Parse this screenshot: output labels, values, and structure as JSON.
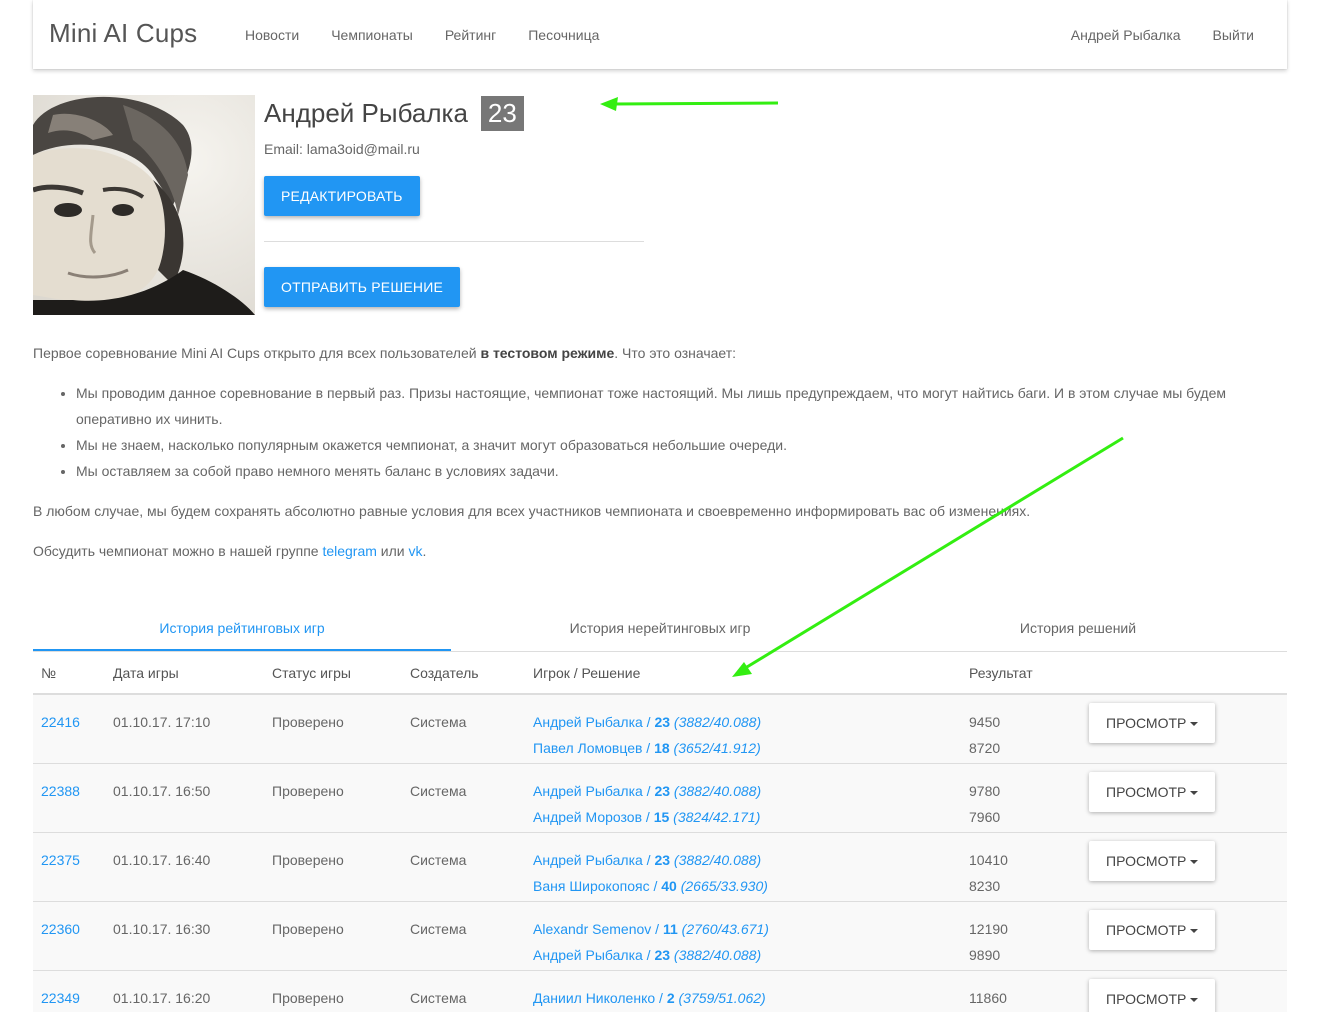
{
  "navbar": {
    "brand": "Mini AI Cups",
    "links": [
      "Новости",
      "Чемпионаты",
      "Рейтинг",
      "Песочница"
    ],
    "user": "Андрей Рыбалка",
    "logout": "Выйти"
  },
  "profile": {
    "name": "Андрей Рыбалка",
    "rating": "23",
    "email": "Email: lama3oid@mail.ru",
    "edit_button": "Редактировать",
    "submit_button": "Отправить решение"
  },
  "content": {
    "intro_pre": "Первое соревнование Mini AI Cups открыто для всех пользователей ",
    "intro_bold": "в тестовом режиме",
    "intro_post": ". Что это означает:",
    "bullets": [
      "Мы проводим данное соревнование в первый раз. Призы настоящие, чемпионат тоже настоящий. Мы лишь предупреждаем, что могут найтись баги. И в этом случае мы будем оперативно их чинить.",
      "Мы не знаем, насколько популярным окажется чемпионат, а значит могут образоваться небольшие очереди.",
      "Мы оставляем за собой право немного менять баланс в условиях задачи."
    ],
    "paragraph2": "В любом случае, мы будем сохранять абсолютно равные условия для всех участников чемпионата и своевременно информировать вас об изменениях.",
    "discuss_pre": "Обсудить чемпионат можно в нашей группе ",
    "telegram": "telegram",
    "or": " или ",
    "vk": "vk",
    "dot": "."
  },
  "tabs": [
    "История рейтинговых игр",
    "История нерейтинговых игр",
    "История решений"
  ],
  "table": {
    "headers": [
      "№",
      "Дата игры",
      "Статус игры",
      "Создатель",
      "Игрок / Решение",
      "Результат"
    ],
    "view_label": "Просмотр",
    "rows": [
      {
        "num": "22416",
        "date": "01.10.17. 17:10",
        "status": "Проверено",
        "creator": "Система",
        "players": [
          {
            "name": "Андрей Рыбалка",
            "sep": " / ",
            "rank": "23",
            "extra": " (3882/40.088)",
            "result": "9450"
          },
          {
            "name": "Павел Ломовцев",
            "sep": " / ",
            "rank": "18",
            "extra": " (3652/41.912)",
            "result": "8720"
          }
        ]
      },
      {
        "num": "22388",
        "date": "01.10.17. 16:50",
        "status": "Проверено",
        "creator": "Система",
        "players": [
          {
            "name": "Андрей Рыбалка",
            "sep": " / ",
            "rank": "23",
            "extra": " (3882/40.088)",
            "result": "9780"
          },
          {
            "name": "Андрей Морозов",
            "sep": " / ",
            "rank": "15",
            "extra": " (3824/42.171)",
            "result": "7960"
          }
        ]
      },
      {
        "num": "22375",
        "date": "01.10.17. 16:40",
        "status": "Проверено",
        "creator": "Система",
        "players": [
          {
            "name": "Андрей Рыбалка",
            "sep": " / ",
            "rank": "23",
            "extra": " (3882/40.088)",
            "result": "10410"
          },
          {
            "name": "Ваня Широкопояс",
            "sep": " / ",
            "rank": "40",
            "extra": " (2665/33.930)",
            "result": "8230"
          }
        ]
      },
      {
        "num": "22360",
        "date": "01.10.17. 16:30",
        "status": "Проверено",
        "creator": "Система",
        "players": [
          {
            "name": "Alexandr Semenov",
            "sep": " / ",
            "rank": "11",
            "extra": " (2760/43.671)",
            "result": "12190"
          },
          {
            "name": "Андрей Рыбалка",
            "sep": " / ",
            "rank": "23",
            "extra": " (3882/40.088)",
            "result": "9890"
          }
        ]
      },
      {
        "num": "22349",
        "date": "01.10.17. 16:20",
        "status": "Проверено",
        "creator": "Система",
        "players": [
          {
            "name": "Даниил Николенко",
            "sep": " / ",
            "rank": "2",
            "extra": " (3759/51.062)",
            "result": "11860"
          }
        ]
      }
    ]
  },
  "colors": {
    "accent": "#2196f3",
    "badge": "#777777",
    "annotation_arrow": "#33ee11"
  }
}
